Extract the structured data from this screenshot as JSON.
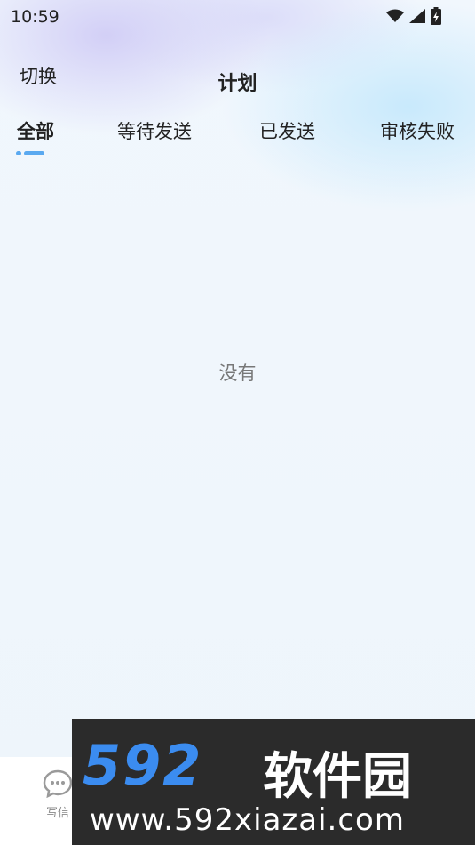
{
  "status_bar": {
    "time": "10:59",
    "icons": [
      "wifi-icon",
      "signal-icon",
      "battery-icon"
    ]
  },
  "header": {
    "switch_label": "切换",
    "title": "计划"
  },
  "tabs": [
    {
      "label": "全部",
      "active": true
    },
    {
      "label": "等待发送",
      "active": false
    },
    {
      "label": "已发送",
      "active": false
    },
    {
      "label": "审核失败",
      "active": false
    }
  ],
  "empty_state": {
    "text": "没有"
  },
  "bottom_nav": {
    "items": [
      {
        "label": "写信",
        "icon": "chat-bubble-icon"
      }
    ]
  },
  "watermark": {
    "number": "592",
    "name": "软件园",
    "url": "www.592xiazai.com"
  },
  "colors": {
    "accent": "#5aa9f0",
    "muted_text": "#777777",
    "watermark_bg": "#2b2b2b",
    "watermark_blue": "#3b8cf0"
  }
}
